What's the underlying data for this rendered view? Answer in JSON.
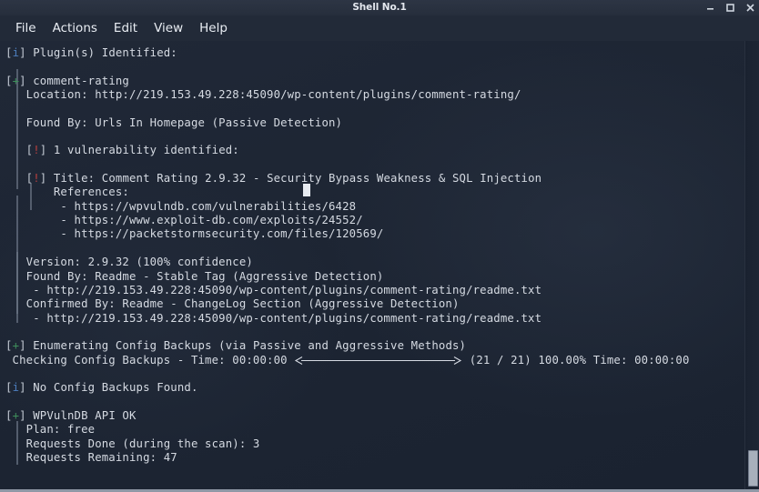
{
  "window": {
    "title": "Shell No.1",
    "buttons": {
      "minimize": "minimize",
      "maximize": "maximize",
      "close": "close"
    }
  },
  "menubar": {
    "items": [
      {
        "label": "File"
      },
      {
        "label": "Actions"
      },
      {
        "label": "Edit"
      },
      {
        "label": "View"
      },
      {
        "label": "Help"
      }
    ]
  },
  "terminal": {
    "lines": [
      {
        "marker": "[i]",
        "marker_kind": "info",
        "text": " Plugin(s) Identified:"
      },
      {
        "marker": "",
        "marker_kind": "none",
        "text": ""
      },
      {
        "marker": "[+]",
        "marker_kind": "plus",
        "text": " comment-rating"
      },
      {
        "marker": "",
        "marker_kind": "none",
        "text": "   Location: http://219.153.49.228:45090/wp-content/plugins/comment-rating/"
      },
      {
        "marker": "",
        "marker_kind": "none",
        "text": ""
      },
      {
        "marker": "",
        "marker_kind": "none",
        "text": "   Found By: Urls In Homepage (Passive Detection)"
      },
      {
        "marker": "",
        "marker_kind": "none",
        "text": ""
      },
      {
        "marker": "   [!]",
        "marker_kind": "warn",
        "text": " 1 vulnerability identified:"
      },
      {
        "marker": "",
        "marker_kind": "none",
        "text": ""
      },
      {
        "marker": "   [!]",
        "marker_kind": "warn",
        "text": " Title: Comment Rating 2.9.32 - Security Bypass Weakness & SQL Injection"
      },
      {
        "marker": "",
        "marker_kind": "none",
        "text": "       References:"
      },
      {
        "marker": "",
        "marker_kind": "none",
        "text": "        - https://wpvulndb.com/vulnerabilities/6428"
      },
      {
        "marker": "",
        "marker_kind": "none",
        "text": "        - https://www.exploit-db.com/exploits/24552/"
      },
      {
        "marker": "",
        "marker_kind": "none",
        "text": "        - https://packetstormsecurity.com/files/120569/"
      },
      {
        "marker": "",
        "marker_kind": "none",
        "text": ""
      },
      {
        "marker": "",
        "marker_kind": "none",
        "text": "   Version: 2.9.32 (100% confidence)"
      },
      {
        "marker": "",
        "marker_kind": "none",
        "text": "   Found By: Readme - Stable Tag (Aggressive Detection)"
      },
      {
        "marker": "",
        "marker_kind": "none",
        "text": "    - http://219.153.49.228:45090/wp-content/plugins/comment-rating/readme.txt"
      },
      {
        "marker": "",
        "marker_kind": "none",
        "text": "   Confirmed By: Readme - ChangeLog Section (Aggressive Detection)"
      },
      {
        "marker": "",
        "marker_kind": "none",
        "text": "    - http://219.153.49.228:45090/wp-content/plugins/comment-rating/readme.txt"
      },
      {
        "marker": "",
        "marker_kind": "none",
        "text": ""
      },
      {
        "marker": "[+]",
        "marker_kind": "plus",
        "text": " Enumerating Config Backups (via Passive and Aggressive Methods)"
      },
      {
        "marker": "",
        "marker_kind": "none",
        "text": " Checking Config Backups - Time: 00:00:00 ⟸⟹ (21 / 21) 100.00% Time: 00:00:00"
      },
      {
        "marker": "",
        "marker_kind": "none",
        "text": ""
      },
      {
        "marker": "[i]",
        "marker_kind": "info",
        "text": " No Config Backups Found."
      },
      {
        "marker": "",
        "marker_kind": "none",
        "text": ""
      },
      {
        "marker": "[+]",
        "marker_kind": "plus",
        "text": " WPVulnDB API OK"
      },
      {
        "marker": "",
        "marker_kind": "none",
        "text": "   Plan: free"
      },
      {
        "marker": "",
        "marker_kind": "none",
        "text": "   Requests Done (during the scan): 3"
      },
      {
        "marker": "",
        "marker_kind": "none",
        "text": "   Requests Remaining: 47"
      }
    ],
    "progress": {
      "label": " Checking Config Backups - Time: ",
      "elapsed": "00:00:00",
      "bar": "⟸⟹",
      "count": " (21 / 21) 100.00% Time: ",
      "eta": "00:00:00"
    },
    "colors": {
      "info_marker": "#4d7fbf",
      "plus_marker": "#3f8f5b",
      "warn_marker": "#b8403f",
      "text": "#d5dae2",
      "background": "#1d2533"
    }
  },
  "scrollbar": {
    "position": "right"
  }
}
